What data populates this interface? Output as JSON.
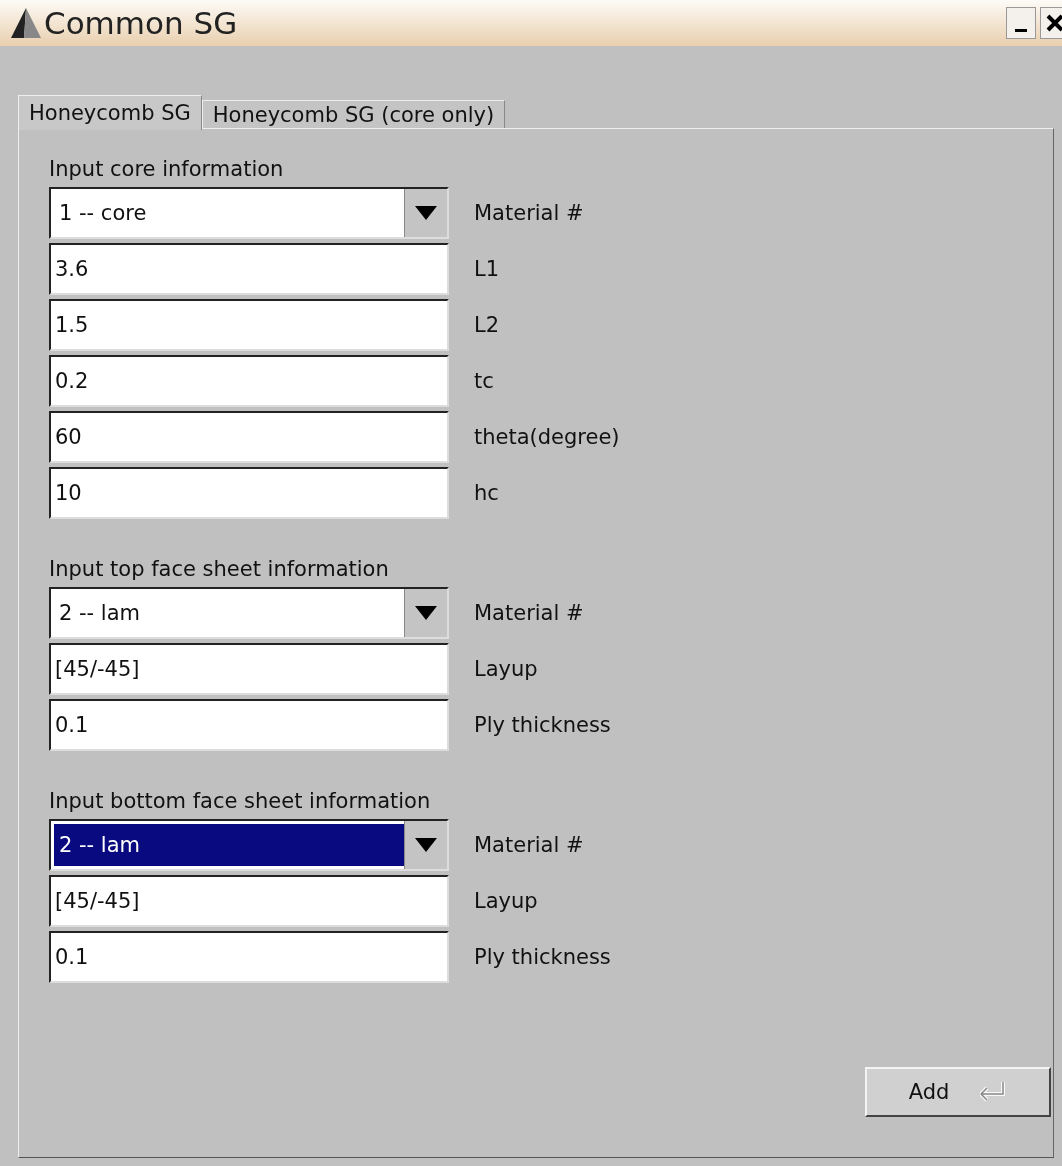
{
  "window": {
    "title": "Common SG"
  },
  "tabs": [
    {
      "label": "Honeycomb SG",
      "selected": true
    },
    {
      "label": "Honeycomb SG (core only)",
      "selected": false
    }
  ],
  "sections": [
    {
      "heading": "Input core information",
      "fields": [
        {
          "kind": "dropdown",
          "value": "1 -- core",
          "label": "Material #",
          "focused": false
        },
        {
          "kind": "text",
          "value": "3.6",
          "label": "L1"
        },
        {
          "kind": "text",
          "value": "1.5",
          "label": "L2"
        },
        {
          "kind": "text",
          "value": "0.2",
          "label": "tc"
        },
        {
          "kind": "text",
          "value": "60",
          "label": "theta(degree)"
        },
        {
          "kind": "text",
          "value": "10",
          "label": "hc"
        }
      ]
    },
    {
      "heading": "Input top face sheet information",
      "fields": [
        {
          "kind": "dropdown",
          "value": "2 -- lam",
          "label": "Material #",
          "focused": false
        },
        {
          "kind": "text",
          "value": "[45/-45]",
          "label": "Layup"
        },
        {
          "kind": "text",
          "value": "0.1",
          "label": "Ply thickness"
        }
      ]
    },
    {
      "heading": "Input bottom face sheet information",
      "fields": [
        {
          "kind": "dropdown",
          "value": "2 -- lam",
          "label": "Material #",
          "focused": true
        },
        {
          "kind": "text",
          "value": "[45/-45]",
          "label": "Layup"
        },
        {
          "kind": "text",
          "value": "0.1",
          "label": "Ply thickness"
        }
      ]
    }
  ],
  "buttons": [
    {
      "label": "Add"
    }
  ]
}
